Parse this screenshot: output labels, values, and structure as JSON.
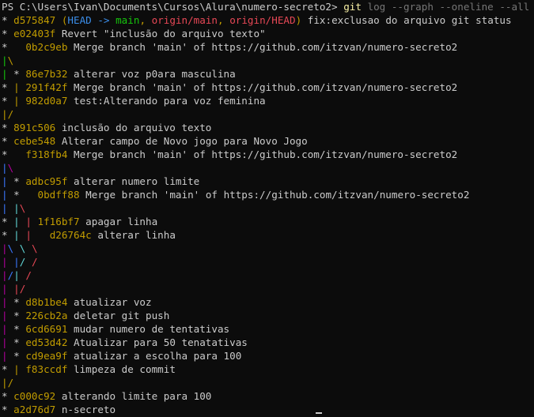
{
  "colors": {
    "default": "#cccccc",
    "hash": "#c19c00",
    "head": "#3b8eea",
    "branch_local": "#16c60c",
    "branch_remote": "#e74856",
    "graph_red": "#e74856",
    "graph_green": "#16c60c",
    "graph_yellow": "#c19c00",
    "graph_blue": "#3b78ff",
    "graph_magenta": "#b4009e",
    "graph_cyan": "#61d6d6",
    "prompt_cmd": "#f9f1a5",
    "prompt_args": "#767676"
  },
  "terminal": {
    "lines": [
      [
        {
          "t": "PS C:\\Users\\Ivan\\Documents\\Cursos\\Alura\\numero-secreto2> ",
          "c": "default"
        },
        {
          "t": "git",
          "c": "prompt_cmd"
        },
        {
          "t": " log --graph --oneline --all",
          "c": "prompt_args"
        }
      ],
      [
        {
          "t": "* ",
          "c": "default"
        },
        {
          "t": "d575847",
          "c": "hash"
        },
        {
          "t": " (",
          "c": "hash"
        },
        {
          "t": "HEAD -> ",
          "c": "head"
        },
        {
          "t": "main",
          "c": "branch_local"
        },
        {
          "t": ", ",
          "c": "hash"
        },
        {
          "t": "origin/main",
          "c": "branch_remote"
        },
        {
          "t": ", ",
          "c": "hash"
        },
        {
          "t": "origin/HEAD",
          "c": "branch_remote"
        },
        {
          "t": ")",
          "c": "hash"
        },
        {
          "t": " fix:exclusao do arquivo git status",
          "c": "default"
        }
      ],
      [
        {
          "t": "* ",
          "c": "default"
        },
        {
          "t": "e02403f",
          "c": "hash"
        },
        {
          "t": " Revert \"inclusão do arquivo texto\"",
          "c": "default"
        }
      ],
      [
        {
          "t": "*   ",
          "c": "default"
        },
        {
          "t": "0b2c9eb",
          "c": "hash"
        },
        {
          "t": " Merge branch 'main' of https://github.com/itzvan/numero-secreto2",
          "c": "default"
        }
      ],
      [
        {
          "t": "|",
          "c": "graph_green"
        },
        {
          "t": "\\",
          "c": "graph_yellow"
        }
      ],
      [
        {
          "t": "| ",
          "c": "graph_green"
        },
        {
          "t": "* ",
          "c": "default"
        },
        {
          "t": "86e7b32",
          "c": "hash"
        },
        {
          "t": " alterar voz p0ara masculina",
          "c": "default"
        }
      ],
      [
        {
          "t": "* ",
          "c": "default"
        },
        {
          "t": "| ",
          "c": "graph_yellow"
        },
        {
          "t": "291f42f",
          "c": "hash"
        },
        {
          "t": " Merge branch 'main' of https://github.com/itzvan/numero-secreto2",
          "c": "default"
        }
      ],
      [
        {
          "t": "* ",
          "c": "default"
        },
        {
          "t": "| ",
          "c": "graph_yellow"
        },
        {
          "t": "982d0a7",
          "c": "hash"
        },
        {
          "t": " test:Alterando para voz feminina",
          "c": "default"
        }
      ],
      [
        {
          "t": "|/",
          "c": "graph_yellow"
        }
      ],
      [
        {
          "t": "* ",
          "c": "default"
        },
        {
          "t": "891c506",
          "c": "hash"
        },
        {
          "t": " inclusão do arquivo texto",
          "c": "default"
        }
      ],
      [
        {
          "t": "* ",
          "c": "default"
        },
        {
          "t": "cebe548",
          "c": "hash"
        },
        {
          "t": " Alterar campo de Novo jogo para Novo Jogo",
          "c": "default"
        }
      ],
      [
        {
          "t": "*   ",
          "c": "default"
        },
        {
          "t": "f318fb4",
          "c": "hash"
        },
        {
          "t": " Merge branch 'main' of https://github.com/itzvan/numero-secreto2",
          "c": "default"
        }
      ],
      [
        {
          "t": "|",
          "c": "graph_blue"
        },
        {
          "t": "\\",
          "c": "graph_magenta"
        }
      ],
      [
        {
          "t": "| ",
          "c": "graph_blue"
        },
        {
          "t": "* ",
          "c": "default"
        },
        {
          "t": "adbc95f",
          "c": "hash"
        },
        {
          "t": " alterar numero limite",
          "c": "default"
        }
      ],
      [
        {
          "t": "| ",
          "c": "graph_blue"
        },
        {
          "t": "*   ",
          "c": "default"
        },
        {
          "t": "0bdff88",
          "c": "hash"
        },
        {
          "t": " Merge branch 'main' of https://github.com/itzvan/numero-secreto2",
          "c": "default"
        }
      ],
      [
        {
          "t": "| ",
          "c": "graph_blue"
        },
        {
          "t": "|",
          "c": "graph_cyan"
        },
        {
          "t": "\\",
          "c": "graph_red"
        }
      ],
      [
        {
          "t": "* ",
          "c": "default"
        },
        {
          "t": "| ",
          "c": "graph_cyan"
        },
        {
          "t": "| ",
          "c": "graph_red"
        },
        {
          "t": "1f16bf7",
          "c": "hash"
        },
        {
          "t": " apagar linha",
          "c": "default"
        }
      ],
      [
        {
          "t": "* ",
          "c": "default"
        },
        {
          "t": "| ",
          "c": "graph_cyan"
        },
        {
          "t": "|   ",
          "c": "graph_red"
        },
        {
          "t": "d26764c",
          "c": "hash"
        },
        {
          "t": " alterar linha",
          "c": "default"
        }
      ],
      [
        {
          "t": "|",
          "c": "graph_magenta"
        },
        {
          "t": "\\ ",
          "c": "graph_blue"
        },
        {
          "t": "\\ ",
          "c": "graph_cyan"
        },
        {
          "t": "\\",
          "c": "graph_red"
        }
      ],
      [
        {
          "t": "| ",
          "c": "graph_magenta"
        },
        {
          "t": "|",
          "c": "graph_blue"
        },
        {
          "t": "/ ",
          "c": "graph_cyan"
        },
        {
          "t": "/",
          "c": "graph_red"
        }
      ],
      [
        {
          "t": "|",
          "c": "graph_magenta"
        },
        {
          "t": "/",
          "c": "graph_blue"
        },
        {
          "t": "| ",
          "c": "graph_cyan"
        },
        {
          "t": "/",
          "c": "graph_red"
        }
      ],
      [
        {
          "t": "| ",
          "c": "graph_magenta"
        },
        {
          "t": "|/",
          "c": "graph_red"
        }
      ],
      [
        {
          "t": "| ",
          "c": "graph_magenta"
        },
        {
          "t": "* ",
          "c": "default"
        },
        {
          "t": "d8b1be4",
          "c": "hash"
        },
        {
          "t": " atualizar voz",
          "c": "default"
        }
      ],
      [
        {
          "t": "| ",
          "c": "graph_magenta"
        },
        {
          "t": "* ",
          "c": "default"
        },
        {
          "t": "226cb2a",
          "c": "hash"
        },
        {
          "t": " deletar git push",
          "c": "default"
        }
      ],
      [
        {
          "t": "| ",
          "c": "graph_magenta"
        },
        {
          "t": "* ",
          "c": "default"
        },
        {
          "t": "6cd6691",
          "c": "hash"
        },
        {
          "t": " mudar numero de tentativas",
          "c": "default"
        }
      ],
      [
        {
          "t": "| ",
          "c": "graph_magenta"
        },
        {
          "t": "* ",
          "c": "default"
        },
        {
          "t": "ed53d42",
          "c": "hash"
        },
        {
          "t": " Atualizar para 50 tenatativas",
          "c": "default"
        }
      ],
      [
        {
          "t": "| ",
          "c": "graph_magenta"
        },
        {
          "t": "* ",
          "c": "default"
        },
        {
          "t": "cd9ea9f",
          "c": "hash"
        },
        {
          "t": " atualizar a escolha para 100",
          "c": "default"
        }
      ],
      [
        {
          "t": "* ",
          "c": "default"
        },
        {
          "t": "| ",
          "c": "graph_yellow"
        },
        {
          "t": "f83ccdf",
          "c": "hash"
        },
        {
          "t": " limpeza de commit",
          "c": "default"
        }
      ],
      [
        {
          "t": "|/",
          "c": "graph_yellow"
        }
      ],
      [
        {
          "t": "* ",
          "c": "default"
        },
        {
          "t": "c000c92",
          "c": "hash"
        },
        {
          "t": " alterando limite para 100",
          "c": "default"
        }
      ],
      [
        {
          "t": "* ",
          "c": "default"
        },
        {
          "t": "a2d76d7",
          "c": "hash"
        },
        {
          "t": " n-secreto",
          "c": "default"
        }
      ]
    ]
  }
}
